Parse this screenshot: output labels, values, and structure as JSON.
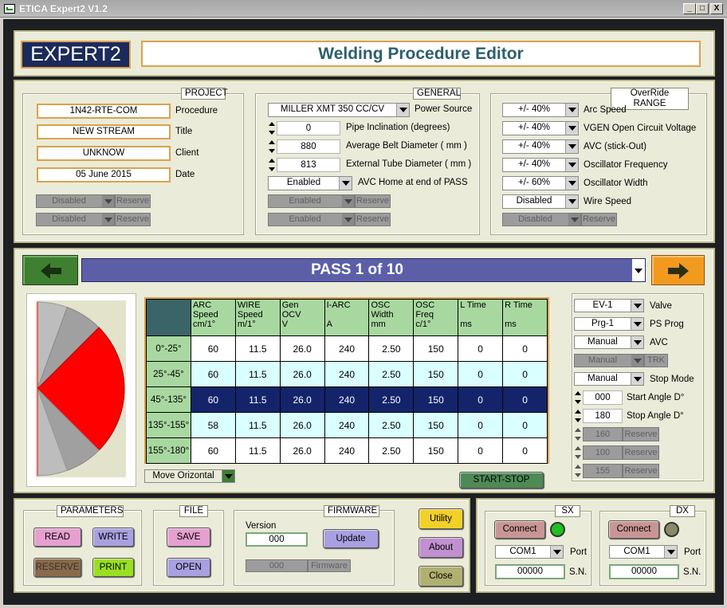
{
  "window": {
    "title": "ETICA Expert2 V1.2",
    "min": "_",
    "max": "□",
    "close": "X"
  },
  "header": {
    "logo": "EXPERT2",
    "title": "Welding Procedure Editor"
  },
  "project": {
    "title": "PROJECT",
    "fields": [
      {
        "value": "1N42-RTE-COM",
        "label": "Procedure"
      },
      {
        "value": "NEW STREAM",
        "label": "Title"
      },
      {
        "value": "UNKNOW",
        "label": "Client"
      },
      {
        "value": "05  June 2015",
        "label": "Date"
      }
    ],
    "reserve": [
      {
        "value": "Disabled",
        "label": "Reserve"
      },
      {
        "value": "Disabled",
        "label": "Reserve"
      }
    ]
  },
  "general": {
    "title": "GENERAL",
    "power_source": {
      "value": "MILLER  XMT 350 CC/CV",
      "label": "Power Source"
    },
    "numbers": [
      {
        "value": "0",
        "label": "Pipe Inclination (degrees)"
      },
      {
        "value": "880",
        "label": "Average Belt Diameter ( mm )"
      },
      {
        "value": "813",
        "label": "External Tube Diameter ( mm )"
      }
    ],
    "avc_home": {
      "value": "Enabled",
      "label": "AVC Home at end of PASS"
    },
    "reserve": [
      {
        "value": "Enabled",
        "label": "Reserve"
      },
      {
        "value": "Enabled",
        "label": "Reserve"
      }
    ]
  },
  "override": {
    "title": "OverRide RANGE",
    "items": [
      {
        "value": "+/- 40%",
        "label": "Arc Speed"
      },
      {
        "value": "+/- 40%",
        "label": "VGEN Open Circuit Voltage"
      },
      {
        "value": "+/- 40%",
        "label": "AVC (stick-Out)"
      },
      {
        "value": "+/- 40%",
        "label": "Oscillator Frequency"
      },
      {
        "value": "+/- 60%",
        "label": "Oscillator Width"
      },
      {
        "value": "Disabled",
        "label": "Wire Speed"
      }
    ],
    "reserve": {
      "value": "Disabled",
      "label": "Reserve"
    }
  },
  "pass": {
    "label": "PASS 1 of 10",
    "prev_icon": "arrow-left-icon",
    "next_icon": "arrow-right-icon"
  },
  "table": {
    "headers": [
      [
        "ARC",
        "Speed",
        "cm/1°"
      ],
      [
        "WIRE",
        "Speed",
        "m/1°"
      ],
      [
        "Gen",
        "OCV",
        "V"
      ],
      [
        "I-ARC",
        "",
        "A"
      ],
      [
        "OSC",
        "Width",
        "mm"
      ],
      [
        "OSC",
        "Freq",
        "c/1°"
      ],
      [
        "L Time",
        "",
        "ms"
      ],
      [
        "R Time",
        "",
        "ms"
      ]
    ],
    "rows": [
      {
        "label": "0°-25°",
        "cells": [
          "60",
          "11.5",
          "26.0",
          "240",
          "2.50",
          "150",
          "0",
          "0"
        ]
      },
      {
        "label": "25°-45°",
        "cells": [
          "60",
          "11.5",
          "26.0",
          "240",
          "2.50",
          "150",
          "0",
          "0"
        ]
      },
      {
        "label": "45°-135°",
        "cells": [
          "60",
          "11.5",
          "26.0",
          "240",
          "2.50",
          "150",
          "0",
          "0"
        ]
      },
      {
        "label": "135°-155°",
        "cells": [
          "58",
          "11.5",
          "26.0",
          "240",
          "2.50",
          "150",
          "0",
          "0"
        ]
      },
      {
        "label": "155°-180°",
        "cells": [
          "60",
          "11.5",
          "26.0",
          "240",
          "2.50",
          "150",
          "0",
          "0"
        ]
      }
    ],
    "selected_row": 2
  },
  "move_mode": "Move Orizontal",
  "start_stop": "START-STOP",
  "side": {
    "valve": {
      "value": "EV-1",
      "label": "Valve"
    },
    "ps_prog": {
      "value": "Prg-1",
      "label": "PS Prog"
    },
    "avc": {
      "value": "Manual",
      "label": "AVC"
    },
    "trk": {
      "value": "Manual",
      "label": "TRK"
    },
    "stop_mode": {
      "value": "Manual",
      "label": "Stop Mode"
    },
    "start_angle": {
      "value": "000",
      "label": "Start Angle D°"
    },
    "stop_angle": {
      "value": "180",
      "label": "Stop Angle D°"
    },
    "reserve": [
      {
        "value": "160",
        "label": "Reserve"
      },
      {
        "value": "100",
        "label": "Reserve"
      },
      {
        "value": "155",
        "label": "Reserve"
      }
    ]
  },
  "parameters": {
    "title": "PARAMETERS",
    "read": "READ",
    "write": "WRITE",
    "reserve": "RESERVE",
    "print": "PRINT"
  },
  "file": {
    "title": "FILE",
    "save": "SAVE",
    "open": "OPEN"
  },
  "firmware": {
    "title": "FIRMWARE",
    "version_label": "Version",
    "version": "000",
    "update": "Update",
    "fw_value": "000",
    "fw_label": "Firmware"
  },
  "actions": {
    "utility": "Utility",
    "about": "About",
    "close": "Close"
  },
  "sx": {
    "title": "SX",
    "connect": "Connect",
    "port": "COM1",
    "port_label": "Port",
    "sn": "00000",
    "sn_label": "S.N.",
    "led": "#20c020"
  },
  "dx": {
    "title": "DX",
    "connect": "Connect",
    "port": "COM1",
    "port_label": "Port",
    "sn": "00000",
    "sn_label": "S.N.",
    "led": "#8a8a6a"
  },
  "colors": {
    "accent": "#5c5fa8",
    "green": "#3f7f32",
    "orange": "#f29a1e",
    "header_green": "#a8d8a0",
    "selected": "#14246a",
    "row_alt": "#d9ffff",
    "pie": "#ff0000"
  }
}
